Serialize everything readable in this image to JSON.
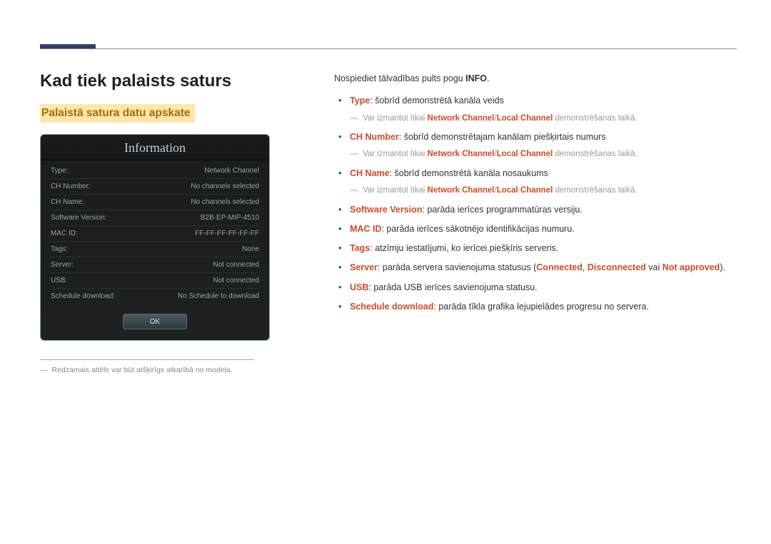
{
  "headings": {
    "h1": "Kad tiek palaists saturs",
    "h2": "Palaistā satura datu apskate"
  },
  "infoPanel": {
    "title": "Information",
    "rows": [
      {
        "label": "Type:",
        "value": "Network Channel"
      },
      {
        "label": "CH Number:",
        "value": "No channels selected"
      },
      {
        "label": "CH Name:",
        "value": "No channels selected"
      },
      {
        "label": "Software Version:",
        "value": "B2B-EP-MIP-4510"
      },
      {
        "label": "MAC ID:",
        "value": "FF-FF-FF-FF-FF-FF"
      },
      {
        "label": "Tags:",
        "value": "None"
      },
      {
        "label": "Server:",
        "value": "Not connected"
      },
      {
        "label": "USB:",
        "value": "Not connected"
      },
      {
        "label": "Schedule download:",
        "value": "No Schedule to download"
      }
    ],
    "okLabel": "OK"
  },
  "footnote": "Redzamais attēls var būt atšķirīgs atkarībā no modeļa.",
  "intro": {
    "prefix": "Nospiediet tālvadības pults pogu ",
    "bold": "INFO",
    "suffix": "."
  },
  "bullets": {
    "type": {
      "term": "Type",
      "rest": ": šobrīd demonstrētā kanāla veids"
    },
    "subNote": {
      "p1": "Var izmantot tikai ",
      "b1": "Network Channel",
      "slash": "/",
      "b2": "Local Channel",
      "p2": " demonstrēšanas laikā."
    },
    "chNumber": {
      "term": "CH Number",
      "rest": ": šobrīd demonstrētajam kanālam piešķirtais numurs"
    },
    "chName": {
      "term": "CH Name",
      "rest": ": šobrīd demonstrētā kanāla nosaukums"
    },
    "softwareVersion": {
      "term": "Software Version",
      "rest": ": parāda ierīces programmatūras versiju."
    },
    "macId": {
      "term": "MAC ID",
      "rest": ": parāda ierīces sākotnējo identifikācijas numuru."
    },
    "tags": {
      "term": "Tags",
      "rest": ": atzīmju iestatījumi, ko ierīcei piešķīris serveris."
    },
    "server": {
      "term": "Server",
      "p1": ": parāda servera savienojuma statusus (",
      "s1": "Connected",
      "c1": ", ",
      "s2": "Disconnected",
      "c2": " vai ",
      "s3": "Not approved",
      "p2": ")."
    },
    "usb": {
      "term": "USB",
      "rest": ": parāda USB ierīces savienojuma statusu."
    },
    "schedule": {
      "term": "Schedule download",
      "rest": ": parāda tīkla grafika lejupielādes progresu no servera."
    }
  }
}
